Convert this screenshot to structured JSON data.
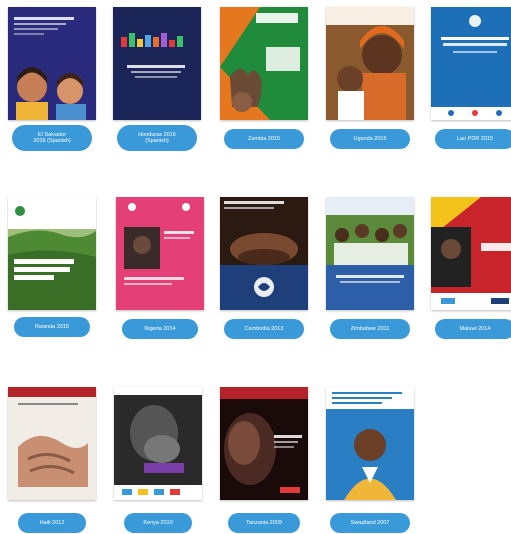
{
  "reports": [
    {
      "label": "El Salvador\n2016 (Spanish)",
      "cover_theme": "cartoon-faces",
      "bg": "#2a2b7c"
    },
    {
      "label": "Honduras 2016\n(Spanish)",
      "cover_theme": "dark-navy-graphic",
      "bg": "#1c2557"
    },
    {
      "label": "Zambia 2015",
      "cover_theme": "orange-green-hand",
      "bg": "#e5781f"
    },
    {
      "label": "Uganda 2015",
      "cover_theme": "mother-and-child-photo",
      "bg": "#8a5a2e"
    },
    {
      "label": "Lao PDR 2015",
      "cover_theme": "blue-title-cover",
      "bg": "#1d6fb8"
    },
    {
      "label": "Rwanda 2015",
      "cover_theme": "green-landscape",
      "bg": "#3f7a2d"
    },
    {
      "label": "Nigeria 2014",
      "cover_theme": "pink-photo-cover",
      "bg": "#e43f76"
    },
    {
      "label": "Cambodia 2013",
      "cover_theme": "child-face-dark-blue",
      "bg": "#1f3f7a"
    },
    {
      "label": "Zimbabwe 2011",
      "cover_theme": "students-photo",
      "bg": "#2d5fa8"
    },
    {
      "label": "Malawi 2014",
      "cover_theme": "red-yellow-diagonal",
      "bg": "#c8242b"
    },
    {
      "label": "Haiti 2012",
      "cover_theme": "hands-photo",
      "bg": "#b5232a"
    },
    {
      "label": "Kenya 2010",
      "cover_theme": "black-white-photo",
      "bg": "#2a2a2a"
    },
    {
      "label": "Tanzania 2009",
      "cover_theme": "dark-red-photo",
      "bg": "#5a0f0f"
    },
    {
      "label": "Swaziland 2007",
      "cover_theme": "boy-blue-sky",
      "bg": "#2a7fc4"
    }
  ]
}
